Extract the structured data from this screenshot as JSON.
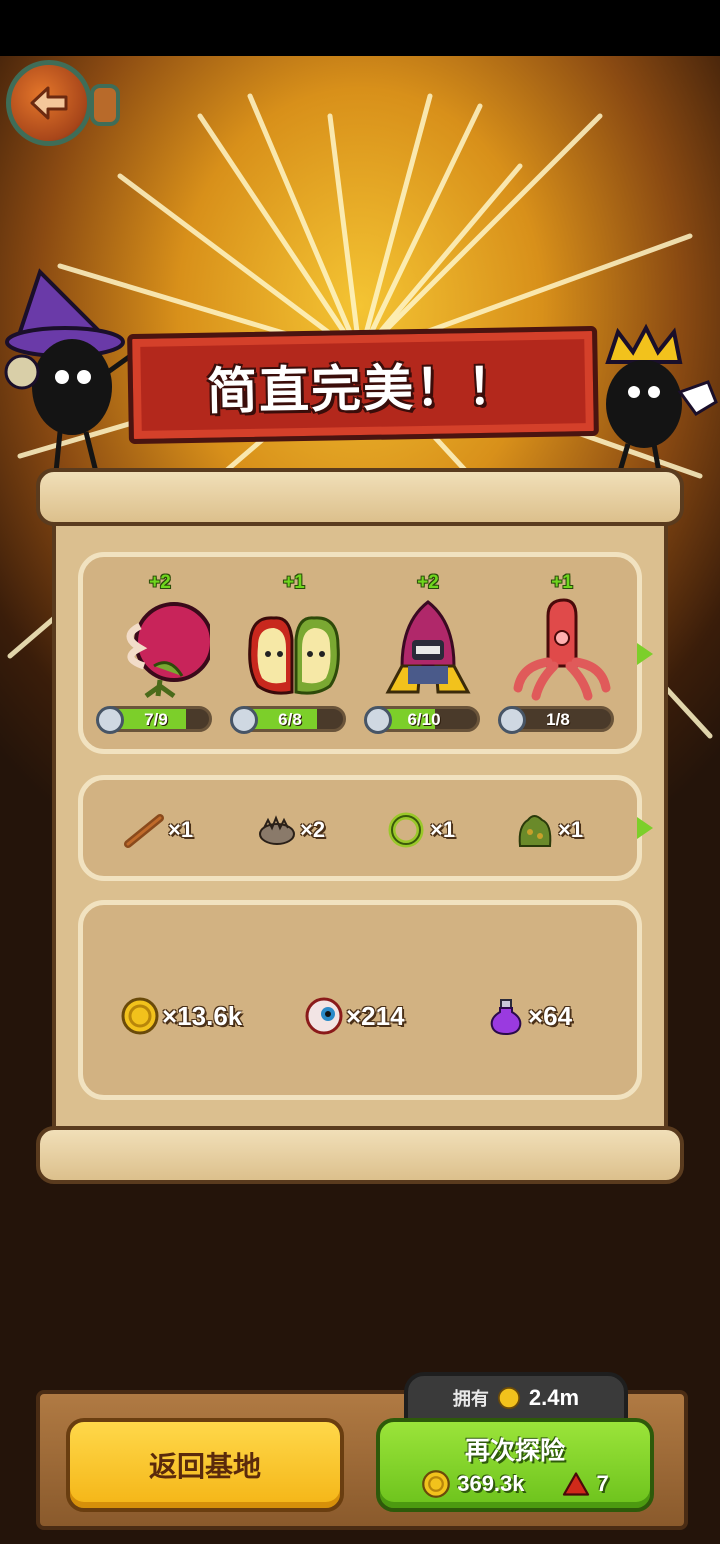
{
  "banner": {
    "title": "简直完美！！"
  },
  "heroes": [
    {
      "name_icon": "carnivorous-plant-icon",
      "plus": "+2",
      "progress": "7/9",
      "fraction": 0.78
    },
    {
      "name_icon": "apple-twins-icon",
      "plus": "+1",
      "progress": "6/8",
      "fraction": 0.75
    },
    {
      "name_icon": "rocket-robot-icon",
      "plus": "+2",
      "progress": "6/10",
      "fraction": 0.6
    },
    {
      "name_icon": "octopus-icon",
      "plus": "+1",
      "progress": "1/8",
      "fraction": 0.12
    }
  ],
  "items": [
    {
      "icon": "wood-stick-icon",
      "count": "×1"
    },
    {
      "icon": "hedgehog-icon",
      "count": "×2"
    },
    {
      "icon": "green-ring-icon",
      "count": "×1"
    },
    {
      "icon": "moss-cluster-icon",
      "count": "×1"
    }
  ],
  "rewards": [
    {
      "icon": "gold-coin-icon",
      "count": "×13.6k"
    },
    {
      "icon": "eyeball-icon",
      "count": "×214"
    },
    {
      "icon": "purple-potion-icon",
      "count": "×64"
    }
  ],
  "footer": {
    "have_label": "拥有",
    "have_value": "2.4m",
    "return_base": "返回基地",
    "explore_again": "再次探险",
    "cost_coins": "369.3k",
    "cost_gems": "7"
  },
  "colors": {
    "banner_red": "#b3281c",
    "progress_green": "#7ccf2a",
    "button_yellow": "#f4b516",
    "button_green": "#6cc21c",
    "parchment": "#dbbf8f"
  }
}
